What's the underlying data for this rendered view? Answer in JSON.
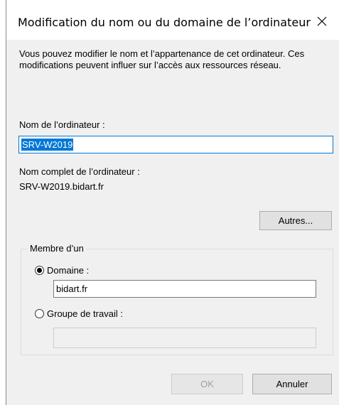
{
  "dialog": {
    "title": "Modification du nom ou du domaine de l’ordinateur",
    "close_glyph": "✕"
  },
  "description": "Vous pouvez modifier le nom et l’appartenance de cet ordinateur. Ces modifications peuvent influer sur l’accès aux ressources réseau.",
  "computer_name": {
    "label": "Nom de l’ordinateur :",
    "value": "SRV-W2019"
  },
  "full_name": {
    "label": "Nom complet de l’ordinateur :",
    "value": "SRV-W2019.bidart.fr"
  },
  "more_button": "Autres...",
  "membership": {
    "group_label": "Membre d’un",
    "domain_option": "Domaine :",
    "domain_value": "bidart.fr",
    "workgroup_option": "Groupe de travail :",
    "workgroup_value": "",
    "selected": "domain"
  },
  "buttons": {
    "ok": "OK",
    "cancel": "Annuler"
  }
}
